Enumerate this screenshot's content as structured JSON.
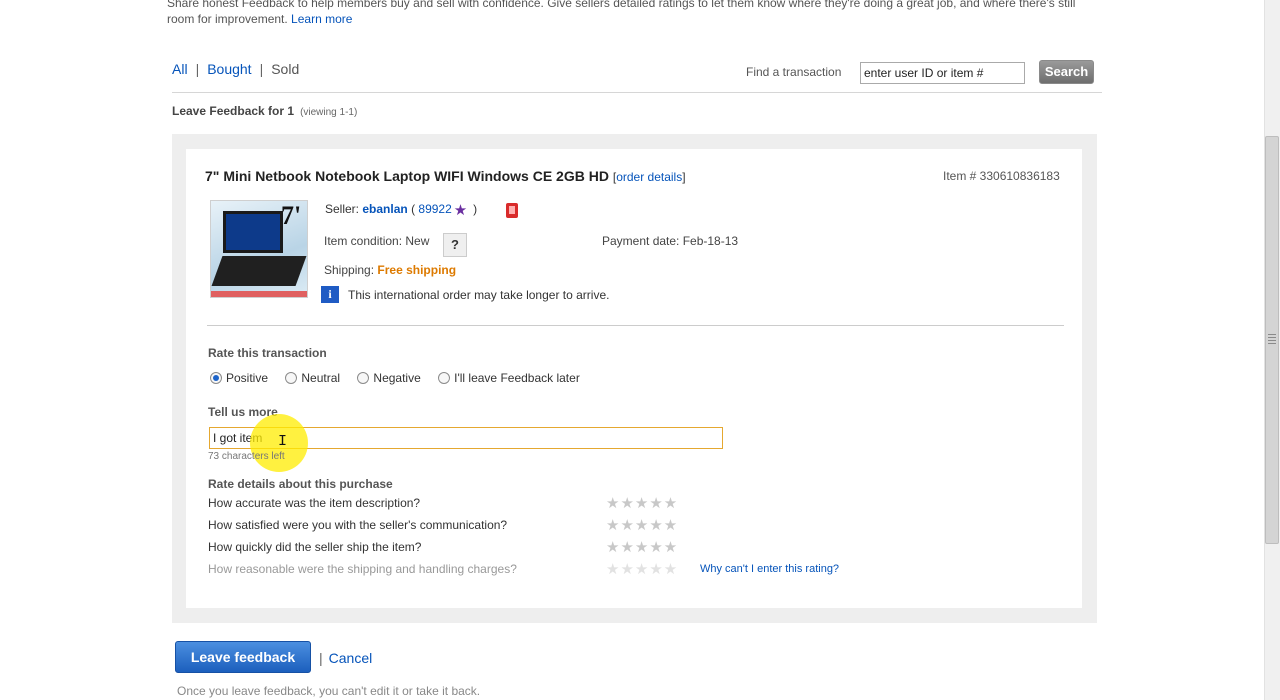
{
  "intro": {
    "text": "Share honest Feedback to help members buy and sell with confidence. Give sellers detailed ratings to let them know where they're doing a great job, and where there's still room for improvement.",
    "learn_more": "Learn more"
  },
  "filters": {
    "all": "All",
    "sep": "|",
    "bought": "Bought",
    "sold": "Sold"
  },
  "find": {
    "label": "Find a transaction",
    "value": "enter user ID or item #",
    "search_label": "Search"
  },
  "leave_heading": {
    "text": "Leave Feedback for 1",
    "viewing": "(viewing 1-1)"
  },
  "item": {
    "title": "7\" Mini Netbook Notebook Laptop WIFI Windows CE 2GB HD",
    "bracket_open": "[",
    "order_details": "order details",
    "bracket_close": "]",
    "item_number": "Item # 330610836183",
    "thumb_text": "7'",
    "seller_label": "Seller:",
    "seller_name": "ebanlan",
    "paren_open": "(",
    "seller_score": "89922",
    "paren_close": ")",
    "condition": "Item condition:  New",
    "condition_help": "?",
    "payment_date": "Payment date: Feb-18-13",
    "shipping_label": "Shipping:",
    "shipping_value": "Free shipping",
    "info_glyph": "i",
    "intl_note": "This international order may take longer to arrive."
  },
  "rating": {
    "title": "Rate this transaction",
    "options": [
      "Positive",
      "Neutral",
      "Negative",
      "I'll leave Feedback later"
    ],
    "selected": "Positive"
  },
  "comment": {
    "label": "Tell us more",
    "value": "I got item ",
    "chars_left": "73 characters left"
  },
  "details": {
    "title": "Rate details about this purchase",
    "questions": [
      "How accurate was the item description?",
      "How satisfied were you with the seller's communication?",
      "How quickly did the seller ship the item?",
      "How reasonable were the shipping and handling charges?"
    ],
    "stars": "★★★★★",
    "why_link": "Why can't I enter this rating?"
  },
  "actions": {
    "leave_feedback": "Leave feedback",
    "sep": "|",
    "cancel": "Cancel",
    "note": "Once you leave feedback, you can't edit it or take it back."
  },
  "colors": {
    "link": "#0654ba",
    "free_shipping": "#dd7a00",
    "primary_button": "#1c5fbd",
    "input_focus": "#e5a830",
    "cursor_highlight": "#ffec00"
  }
}
